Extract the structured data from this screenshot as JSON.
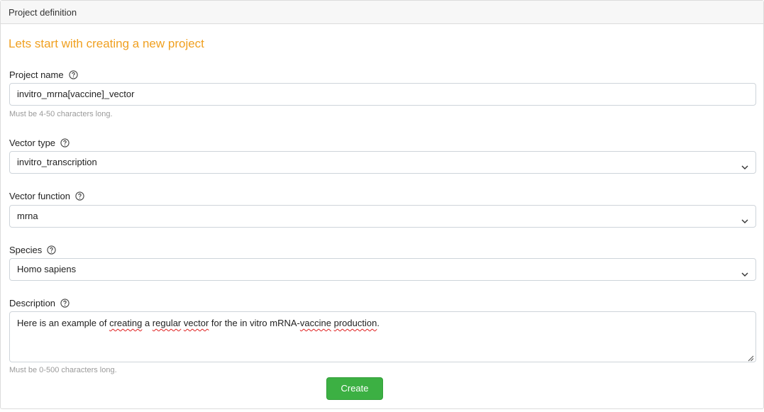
{
  "header": {
    "title": "Project definition"
  },
  "form": {
    "heading": "Lets start with creating a new project",
    "project_name": {
      "label": "Project name",
      "value": "invitro_mrna[vaccine]_vector",
      "hint": "Must be 4-50 characters long."
    },
    "vector_type": {
      "label": "Vector type",
      "value": "invitro_transcription"
    },
    "vector_function": {
      "label": "Vector function",
      "value": "mrna"
    },
    "species": {
      "label": "Species",
      "value": "Homo sapiens"
    },
    "description": {
      "label": "Description",
      "value_parts": [
        "Here is an example of ",
        "creating",
        " a ",
        "regular",
        " ",
        "vector",
        " for the in vitro mRNA-",
        "vaccine",
        " ",
        "production",
        "."
      ],
      "hint": "Must be 0-500 characters long."
    },
    "submit_label": "Create"
  },
  "icons": {
    "help": "help-circle-icon",
    "dropdown": "chevron-down-icon",
    "resize": "resize-handle-icon"
  },
  "colors": {
    "heading": "#f0a020",
    "button": "#3cb043",
    "spellcheck": "#e02020"
  }
}
